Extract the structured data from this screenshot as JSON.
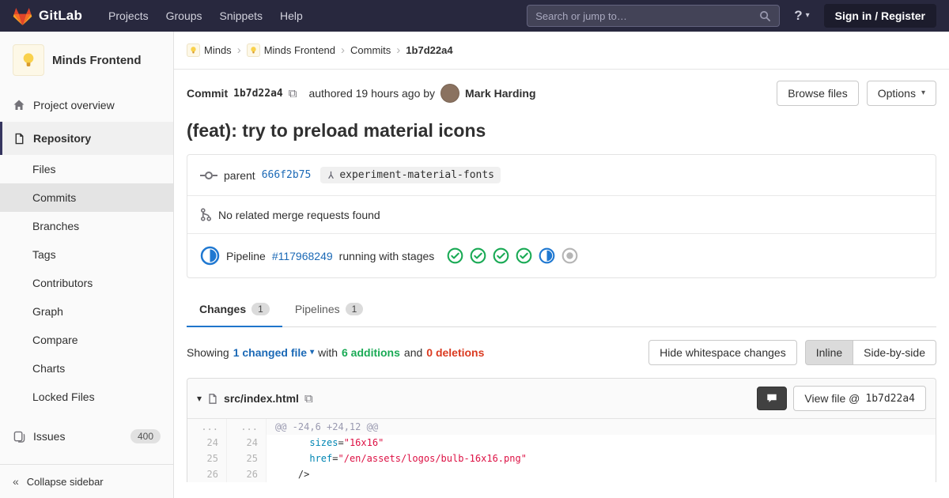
{
  "navbar": {
    "brand": "GitLab",
    "menu": [
      "Projects",
      "Groups",
      "Snippets",
      "Help"
    ],
    "search_placeholder": "Search or jump to…",
    "help_symbol": "?",
    "signin": "Sign in / Register"
  },
  "sidebar": {
    "project_name": "Minds Frontend",
    "overview": "Project overview",
    "repository": "Repository",
    "sub_items": [
      "Files",
      "Commits",
      "Branches",
      "Tags",
      "Contributors",
      "Graph",
      "Compare",
      "Charts",
      "Locked Files"
    ],
    "issues": "Issues",
    "issues_count": "400",
    "collapse": "Collapse sidebar"
  },
  "breadcrumbs": {
    "group": "Minds",
    "project": "Minds Frontend",
    "section": "Commits",
    "sha": "1b7d22a4"
  },
  "commit": {
    "label": "Commit",
    "sha": "1b7d22a4",
    "authored": "authored 19 hours ago by",
    "author": "Mark Harding",
    "browse_files": "Browse files",
    "options": "Options",
    "title": "(feat): try to preload material icons",
    "parent_label": "parent",
    "parent_sha": "666f2b75",
    "ref_name": "experiment-material-fonts",
    "no_merge_requests": "No related merge requests found",
    "pipeline_label": "Pipeline",
    "pipeline_id": "#117968249",
    "pipeline_suffix": "running with stages",
    "stages": [
      "success",
      "success",
      "success",
      "success",
      "running",
      "created"
    ]
  },
  "tabs": {
    "changes": "Changes",
    "changes_count": "1",
    "pipelines": "Pipelines",
    "pipelines_count": "1"
  },
  "controls": {
    "showing": "Showing",
    "changed_file": "1 changed file",
    "with_text": "with",
    "additions": "6 additions",
    "and_text": "and",
    "deletions": "0 deletions",
    "hide_whitespace": "Hide whitespace changes",
    "inline": "Inline",
    "side_by_side": "Side-by-side"
  },
  "diff": {
    "file_path": "src/index.html",
    "view_file": "View file @",
    "view_sha": "1b7d22a4",
    "hunk_old": "...",
    "hunk_new": "...",
    "hunk": "@@ -24,6 +24,12 @@",
    "lines": [
      {
        "old": "24",
        "new": "24",
        "indent": "      ",
        "attr": "sizes",
        "eq": "=",
        "value": "\"16x16\""
      },
      {
        "old": "25",
        "new": "25",
        "indent": "      ",
        "attr": "href",
        "eq": "=",
        "value": "\"/en/assets/logos/bulb-16x16.png\""
      },
      {
        "old": "26",
        "new": "26",
        "indent": "    ",
        "text": "/>"
      }
    ]
  },
  "colors": {
    "brand_orange": "#fc6d26",
    "navbar_bg": "#28283e",
    "success_green": "#1aaa55",
    "running_blue": "#1f78d1",
    "link_blue": "#1b69b6",
    "deletion_red": "#db3b21"
  }
}
